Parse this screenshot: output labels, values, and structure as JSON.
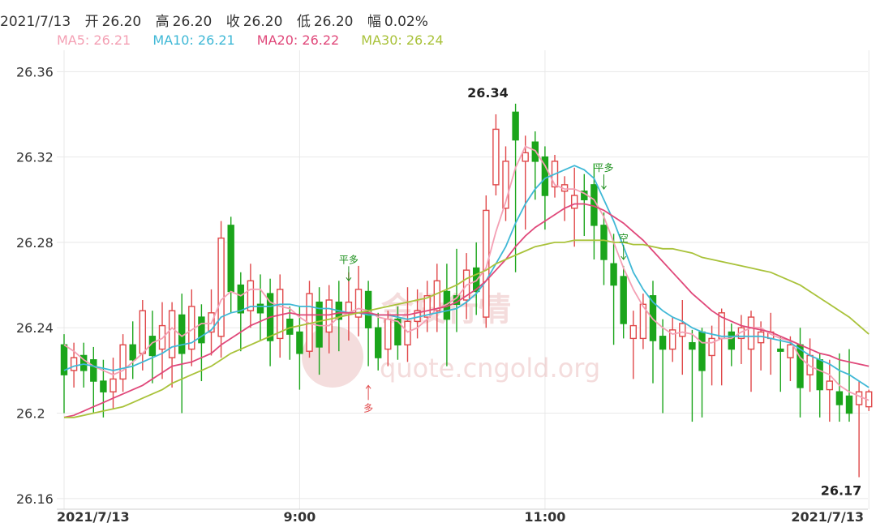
{
  "header": {
    "date": "2021/7/13",
    "open_label": "开",
    "open": "26.20",
    "high_label": "高",
    "high": "26.20",
    "close_label": "收",
    "close": "26.20",
    "low_label": "低",
    "low": "26.20",
    "change_label": "幅",
    "change": "0.02%"
  },
  "ma_legend": [
    {
      "label": "MA5: 26.21",
      "color": "#f4a0b4"
    },
    {
      "label": "MA10: 26.21",
      "color": "#3fb8d6"
    },
    {
      "label": "MA20: 26.22",
      "color": "#e0487a"
    },
    {
      "label": "MA30: 26.24",
      "color": "#a9c23a"
    }
  ],
  "watermark": {
    "cn": "金投行情",
    "url": "quote.cngold.org"
  },
  "colors": {
    "up": "#e0484a",
    "down": "#1ba51b",
    "grid": "#e8e8e8"
  },
  "chart_data": {
    "type": "candlestick",
    "title": "",
    "ylim": [
      26.155,
      26.37
    ],
    "yticks": [
      "26.36",
      "26.32",
      "26.28",
      "26.24",
      "26.2",
      "26.16"
    ],
    "xticks": [
      {
        "label": "2021/7/13",
        "index": 0
      },
      {
        "label": "9:00",
        "index": 24
      },
      {
        "label": "11:00",
        "index": 49
      },
      {
        "label": "2021/7/13",
        "index": 82
      }
    ],
    "annotations": [
      {
        "text": "26.34",
        "index": 44,
        "value": 26.345
      },
      {
        "text": "26.17",
        "index": 80,
        "value": 26.17
      }
    ],
    "signals": [
      {
        "text": "平多",
        "index": 29,
        "value": 26.262,
        "direction": "down"
      },
      {
        "text": "多",
        "index": 31,
        "value": 26.213,
        "direction": "up"
      },
      {
        "text": "平多",
        "index": 55,
        "value": 26.305,
        "direction": "down"
      },
      {
        "text": "空",
        "index": 57,
        "value": 26.272,
        "direction": "down"
      }
    ],
    "candles": [
      [
        26.232,
        26.218,
        26.237,
        26.2
      ],
      [
        26.22,
        26.226,
        26.233,
        26.212
      ],
      [
        26.227,
        26.22,
        26.233,
        26.212
      ],
      [
        26.225,
        26.215,
        26.231,
        26.2
      ],
      [
        26.215,
        26.21,
        26.225,
        26.198
      ],
      [
        26.21,
        26.216,
        26.226,
        26.202
      ],
      [
        26.216,
        26.232,
        26.237,
        26.21
      ],
      [
        26.232,
        26.225,
        26.243,
        26.216
      ],
      [
        26.228,
        26.248,
        26.253,
        26.22
      ],
      [
        26.236,
        26.227,
        26.248,
        26.214
      ],
      [
        26.23,
        26.241,
        26.252,
        26.216
      ],
      [
        26.226,
        26.248,
        26.252,
        26.212
      ],
      [
        26.246,
        26.228,
        26.256,
        26.2
      ],
      [
        26.23,
        26.25,
        26.258,
        26.222
      ],
      [
        26.245,
        26.233,
        26.251,
        26.215
      ],
      [
        26.238,
        26.247,
        26.258,
        26.227
      ],
      [
        26.236,
        26.282,
        26.29,
        26.226
      ],
      [
        26.288,
        26.257,
        26.292,
        26.247
      ],
      [
        26.26,
        26.247,
        26.266,
        26.229
      ],
      [
        26.248,
        26.262,
        26.27,
        26.24
      ],
      [
        26.251,
        26.247,
        26.265,
        26.234
      ],
      [
        26.256,
        26.234,
        26.263,
        26.222
      ],
      [
        26.235,
        26.258,
        26.265,
        26.226
      ],
      [
        26.244,
        26.237,
        26.25,
        26.225
      ],
      [
        26.238,
        26.228,
        26.25,
        26.211
      ],
      [
        26.229,
        26.256,
        26.262,
        26.226
      ],
      [
        26.252,
        26.231,
        26.259,
        26.218
      ],
      [
        26.238,
        26.253,
        26.26,
        26.228
      ],
      [
        26.252,
        26.244,
        26.262,
        26.229
      ],
      [
        26.247,
        26.252,
        26.266,
        26.234
      ],
      [
        26.245,
        26.258,
        26.269,
        26.236
      ],
      [
        26.257,
        26.24,
        26.262,
        26.222
      ],
      [
        26.24,
        26.226,
        26.247,
        26.22
      ],
      [
        26.23,
        26.244,
        26.248,
        26.222
      ],
      [
        26.244,
        26.232,
        26.25,
        26.225
      ],
      [
        26.232,
        26.243,
        26.259,
        26.224
      ],
      [
        26.243,
        26.248,
        26.258,
        26.235
      ],
      [
        26.245,
        26.255,
        26.262,
        26.238
      ],
      [
        26.248,
        26.262,
        26.27,
        26.238
      ],
      [
        26.257,
        26.244,
        26.27,
        26.222
      ],
      [
        26.255,
        26.251,
        26.277,
        26.238
      ],
      [
        26.253,
        26.267,
        26.275,
        26.244
      ],
      [
        26.268,
        26.257,
        26.28,
        26.246
      ],
      [
        26.245,
        26.295,
        26.302,
        26.24
      ],
      [
        26.307,
        26.333,
        26.34,
        26.302
      ],
      [
        26.296,
        26.318,
        26.325,
        26.29
      ],
      [
        26.341,
        26.328,
        26.345,
        26.266
      ],
      [
        26.318,
        26.322,
        26.33,
        26.286
      ],
      [
        26.327,
        26.318,
        26.332,
        26.3
      ],
      [
        26.32,
        26.302,
        26.325,
        26.286
      ],
      [
        26.306,
        26.318,
        26.321,
        26.301
      ],
      [
        26.304,
        26.307,
        26.311,
        26.29
      ],
      [
        26.296,
        26.302,
        26.315,
        26.278
      ],
      [
        26.304,
        26.3,
        26.312,
        26.283
      ],
      [
        26.307,
        26.288,
        26.317,
        26.272
      ],
      [
        26.288,
        26.272,
        26.294,
        26.26
      ],
      [
        26.27,
        26.26,
        26.284,
        26.232
      ],
      [
        26.264,
        26.242,
        26.269,
        26.235
      ],
      [
        26.235,
        26.241,
        26.248,
        26.216
      ],
      [
        26.235,
        26.251,
        26.256,
        26.23
      ],
      [
        26.255,
        26.234,
        26.262,
        26.214
      ],
      [
        26.236,
        26.23,
        26.244,
        26.2
      ],
      [
        26.23,
        26.239,
        26.245,
        26.224
      ],
      [
        26.236,
        26.242,
        26.253,
        26.218
      ],
      [
        26.233,
        26.23,
        26.239,
        26.196
      ],
      [
        26.238,
        26.22,
        26.24,
        26.198
      ],
      [
        26.227,
        26.235,
        26.241,
        26.213
      ],
      [
        26.235,
        26.247,
        26.249,
        26.213
      ],
      [
        26.238,
        26.23,
        26.242,
        26.222
      ],
      [
        26.235,
        26.24,
        26.246,
        26.223
      ],
      [
        26.23,
        26.245,
        26.248,
        26.21
      ],
      [
        26.233,
        26.238,
        26.243,
        26.22
      ],
      [
        26.235,
        26.238,
        26.247,
        26.218
      ],
      [
        26.23,
        26.229,
        26.236,
        26.21
      ],
      [
        26.226,
        26.232,
        26.236,
        26.215
      ],
      [
        26.232,
        26.212,
        26.24,
        26.198
      ],
      [
        26.218,
        26.227,
        26.235,
        26.21
      ],
      [
        26.225,
        26.211,
        26.228,
        26.198
      ],
      [
        26.211,
        26.215,
        26.225,
        26.196
      ],
      [
        26.21,
        26.204,
        26.228,
        26.196
      ],
      [
        26.208,
        26.2,
        26.23,
        26.196
      ],
      [
        26.204,
        26.21,
        26.215,
        26.17
      ],
      [
        26.203,
        26.21,
        26.211,
        26.201
      ]
    ],
    "series": [
      {
        "name": "MA5",
        "values": [
          26.232,
          26.229,
          26.225,
          26.222,
          26.22,
          26.218,
          26.22,
          26.224,
          26.228,
          26.233,
          26.235,
          26.24,
          26.236,
          26.239,
          26.242,
          26.242,
          26.253,
          26.257,
          26.255,
          26.258,
          26.258,
          26.252,
          26.25,
          26.249,
          26.245,
          26.242,
          26.241,
          26.241,
          26.245,
          26.247,
          26.249,
          26.248,
          26.245,
          26.244,
          26.243,
          26.238,
          26.24,
          26.244,
          26.249,
          26.251,
          26.254,
          26.26,
          26.262,
          26.268,
          26.285,
          26.299,
          26.315,
          26.325,
          26.323,
          26.316,
          26.307,
          26.305,
          26.305,
          26.303,
          26.3,
          26.292,
          26.28,
          26.268,
          26.258,
          26.25,
          26.244,
          26.24,
          26.237,
          26.238,
          26.237,
          26.233,
          26.233,
          26.235,
          26.235,
          26.238,
          26.24,
          26.24,
          26.237,
          26.235,
          26.234,
          26.226,
          26.222,
          26.22,
          26.218,
          26.213,
          26.21,
          26.208,
          26.206
        ]
      },
      {
        "name": "MA10",
        "values": [
          26.22,
          26.222,
          26.223,
          26.222,
          26.221,
          26.22,
          26.221,
          26.222,
          26.224,
          26.226,
          26.228,
          26.231,
          26.232,
          26.233,
          26.236,
          26.239,
          26.245,
          26.247,
          26.248,
          26.25,
          26.25,
          26.25,
          26.251,
          26.251,
          26.25,
          26.25,
          26.249,
          26.249,
          26.248,
          26.247,
          26.247,
          26.246,
          26.246,
          26.246,
          26.245,
          26.244,
          26.245,
          26.246,
          26.247,
          26.248,
          26.249,
          26.252,
          26.256,
          26.262,
          26.27,
          26.278,
          26.289,
          26.298,
          26.305,
          26.31,
          26.312,
          26.314,
          26.316,
          26.314,
          26.31,
          26.3,
          26.29,
          26.278,
          26.266,
          26.258,
          26.252,
          26.248,
          26.245,
          26.243,
          26.24,
          26.238,
          26.237,
          26.236,
          26.236,
          26.236,
          26.236,
          26.236,
          26.235,
          26.234,
          26.233,
          26.23,
          26.227,
          26.225,
          26.223,
          26.22,
          26.218,
          26.215,
          26.212
        ]
      },
      {
        "name": "MA20",
        "values": [
          26.198,
          26.199,
          26.201,
          26.203,
          26.205,
          26.207,
          26.209,
          26.211,
          26.213,
          26.216,
          26.219,
          26.222,
          26.223,
          26.224,
          26.226,
          26.228,
          26.232,
          26.235,
          26.238,
          26.241,
          26.243,
          26.245,
          26.246,
          26.247,
          26.246,
          26.246,
          26.246,
          26.246,
          26.247,
          26.247,
          26.247,
          26.247,
          26.246,
          26.246,
          26.246,
          26.246,
          26.247,
          26.248,
          26.249,
          26.25,
          26.252,
          26.255,
          26.258,
          26.262,
          26.267,
          26.272,
          26.278,
          26.283,
          26.287,
          26.29,
          26.293,
          26.296,
          26.298,
          26.298,
          26.297,
          26.295,
          26.292,
          26.289,
          26.285,
          26.281,
          26.276,
          26.271,
          26.266,
          26.261,
          26.256,
          26.252,
          26.248,
          26.245,
          26.243,
          26.241,
          26.24,
          26.239,
          26.238,
          26.236,
          26.234,
          26.232,
          26.23,
          26.228,
          26.227,
          26.225,
          26.224,
          26.223,
          26.222
        ]
      },
      {
        "name": "MA30",
        "values": [
          26.198,
          26.198,
          26.199,
          26.2,
          26.201,
          26.202,
          26.203,
          26.205,
          26.207,
          26.209,
          26.211,
          26.214,
          26.216,
          26.218,
          26.22,
          26.222,
          26.225,
          26.228,
          26.23,
          26.232,
          26.234,
          26.236,
          26.238,
          26.24,
          26.241,
          26.242,
          26.243,
          26.244,
          26.245,
          26.246,
          26.247,
          26.248,
          26.249,
          26.25,
          26.251,
          26.252,
          26.253,
          26.254,
          26.256,
          26.258,
          26.26,
          26.263,
          26.265,
          26.267,
          26.27,
          26.272,
          26.274,
          26.276,
          26.278,
          26.279,
          26.28,
          26.28,
          26.281,
          26.281,
          26.281,
          26.281,
          26.28,
          26.28,
          26.279,
          26.279,
          26.278,
          26.277,
          26.277,
          26.276,
          26.275,
          26.273,
          26.272,
          26.271,
          26.27,
          26.269,
          26.268,
          26.267,
          26.266,
          26.264,
          26.262,
          26.26,
          26.257,
          26.254,
          26.251,
          26.248,
          26.245,
          26.241,
          26.237
        ]
      }
    ]
  }
}
